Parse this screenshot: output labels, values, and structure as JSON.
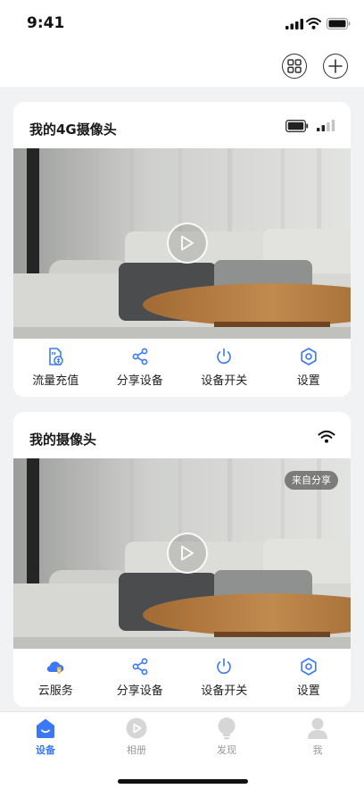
{
  "status_bar": {
    "time": "9:41"
  },
  "cards": [
    {
      "title": "我的4G摄像头",
      "badge": "",
      "actions": [
        {
          "label": "流量充值",
          "icon": "data-recharge-icon"
        },
        {
          "label": "分享设备",
          "icon": "share-icon"
        },
        {
          "label": "设备开关",
          "icon": "power-icon"
        },
        {
          "label": "设置",
          "icon": "gear-icon"
        }
      ]
    },
    {
      "title": "我的摄像头",
      "badge": "来自分享",
      "actions": [
        {
          "label": "云服务",
          "icon": "cloud-service-icon"
        },
        {
          "label": "分享设备",
          "icon": "share-icon"
        },
        {
          "label": "设备开关",
          "icon": "power-icon"
        },
        {
          "label": "设置",
          "icon": "gear-icon"
        }
      ]
    }
  ],
  "tabs": [
    {
      "label": "设备",
      "active": true
    },
    {
      "label": "相册",
      "active": false
    },
    {
      "label": "发现",
      "active": false
    },
    {
      "label": "我",
      "active": false
    }
  ],
  "colors": {
    "accent": "#3b78f5",
    "background": "#f1f2f4",
    "card": "#ffffff"
  }
}
